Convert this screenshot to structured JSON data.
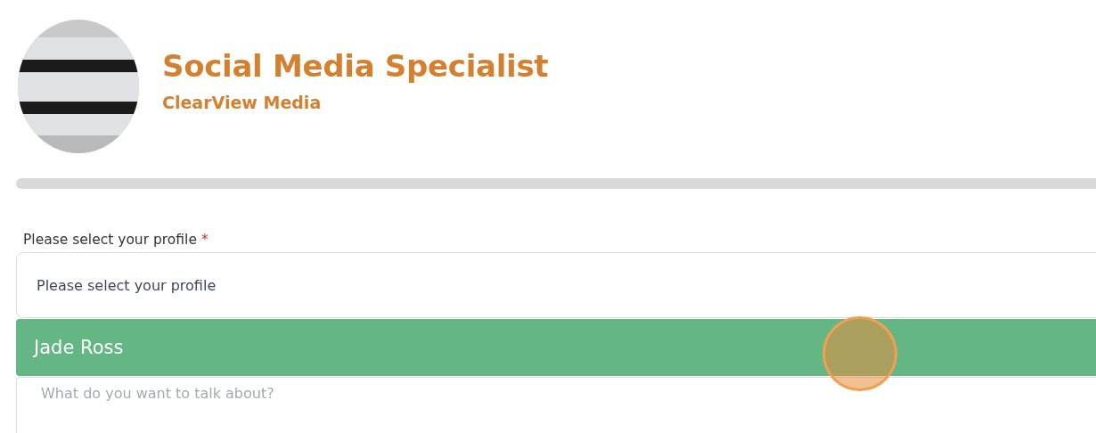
{
  "header": {
    "title": "Social Media Specialist",
    "company": "ClearView Media"
  },
  "profile_field": {
    "label": "Please select your profile",
    "required_mark": "*",
    "placeholder": "Please select your profile",
    "options": [
      {
        "label": "Jade Ross",
        "selected": true
      }
    ]
  },
  "message_field": {
    "placeholder": "What do you want to talk about?"
  }
}
